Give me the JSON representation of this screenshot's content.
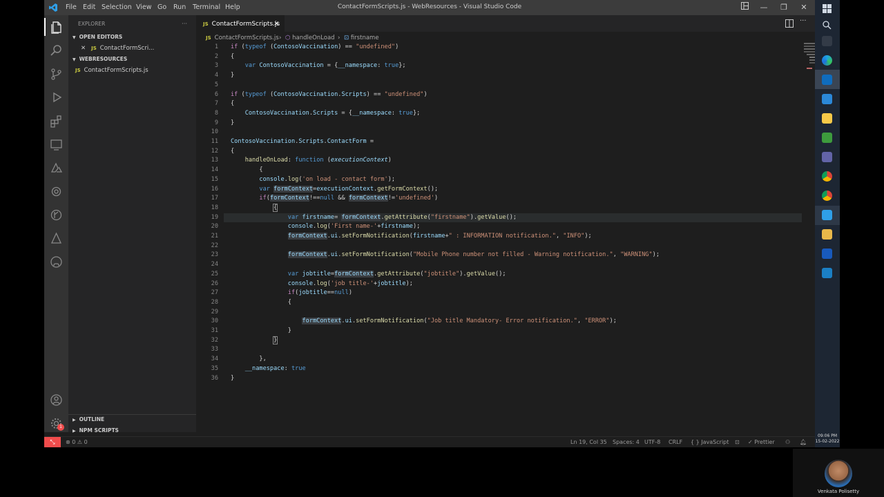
{
  "window": {
    "title": "ContactFormScripts.js - WebResources - Visual Studio Code",
    "menu": [
      "File",
      "Edit",
      "Selection",
      "View",
      "Go",
      "Run",
      "Terminal",
      "Help"
    ]
  },
  "sidebar": {
    "header": "EXPLORER",
    "open_editors": "OPEN EDITORS",
    "open_file": "ContactFormScri...",
    "workspace": "WEBRESOURCES",
    "file": "ContactFormScripts.js",
    "outline": "OUTLINE",
    "npm": "NPM SCRIPTS",
    "js_badge": "JS"
  },
  "tab": {
    "label": "ContactFormScripts.js",
    "close": "✕"
  },
  "breadcrumb": [
    "ContactFormScripts.js",
    "handleOnLoad",
    "firstname"
  ],
  "code": {
    "line_numbers": [
      "1",
      "2",
      "3",
      "4",
      "5",
      "6",
      "7",
      "8",
      "9",
      "10",
      "11",
      "12",
      "13",
      "14",
      "15",
      "16",
      "17",
      "18",
      "19",
      "20",
      "21",
      "22",
      "23",
      "24",
      "25",
      "26",
      "27",
      "28",
      "29",
      "30",
      "31",
      "32",
      "33",
      "34",
      "35",
      "36"
    ]
  },
  "status": {
    "errors": "0",
    "warnings": "0",
    "position": "Ln 19, Col 35",
    "spaces": "Spaces: 4",
    "encoding": "UTF-8",
    "eol": "CRLF",
    "language": "JavaScript",
    "formatter": "Prettier"
  },
  "taskbar": {
    "time": "09:06 PM",
    "date": "15-02-2022"
  },
  "webcam": {
    "name": "Venkata Polisetty"
  }
}
